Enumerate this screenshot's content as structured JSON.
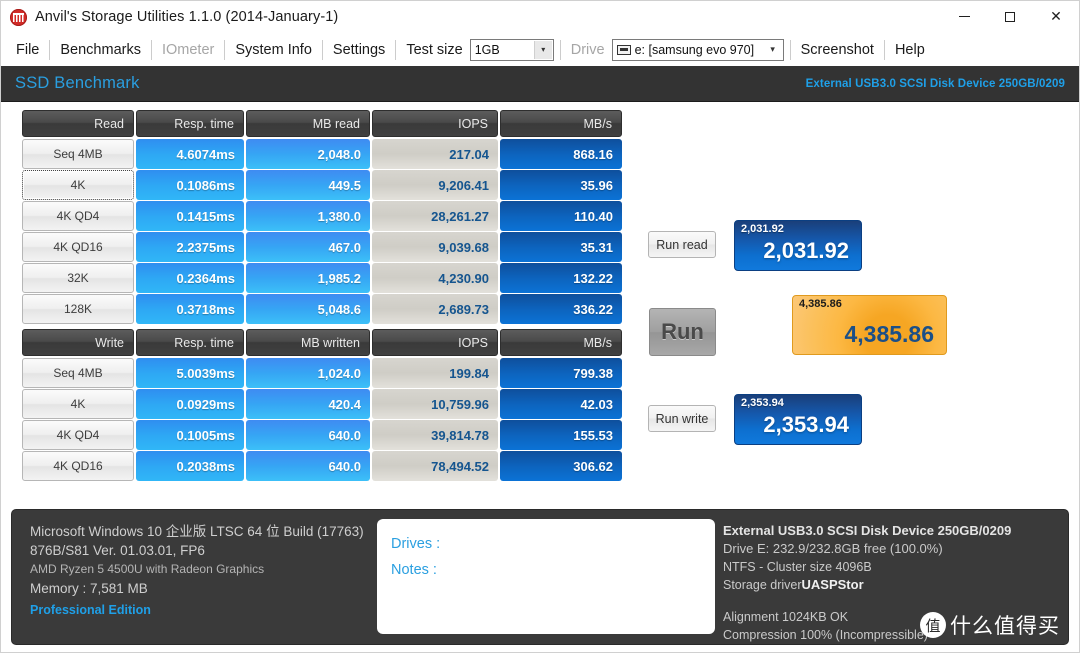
{
  "window": {
    "title": "Anvil's Storage Utilities 1.1.0 (2014-January-1)",
    "icon": "anvil-app-icon",
    "minimize": "–",
    "maximize": "□",
    "close": "✕"
  },
  "menu": {
    "items": [
      {
        "label": "File",
        "disabled": false
      },
      {
        "label": "Benchmarks",
        "disabled": false
      },
      {
        "label": "IOmeter",
        "disabled": true
      },
      {
        "label": "System Info",
        "disabled": false
      },
      {
        "label": "Settings",
        "disabled": false
      }
    ],
    "test_size_label": "Test size",
    "test_size_value": "1GB",
    "drive_label": "Drive",
    "drive_value": "e: [samsung evo 970]",
    "screenshot_label": "Screenshot",
    "help_label": "Help",
    "dropdown_arrow": "▾"
  },
  "header": {
    "title": "SSD Benchmark",
    "device": "External USB3.0 SCSI Disk Device 250GB/0209"
  },
  "read_table": {
    "headers": [
      "Read",
      "Resp. time",
      "MB read",
      "IOPS",
      "MB/s"
    ],
    "rows": [
      {
        "label": "Seq 4MB",
        "resp": "4.6074ms",
        "mb": "2,048.0",
        "iops": "217.04",
        "mbs": "868.16",
        "focused": false
      },
      {
        "label": "4K",
        "resp": "0.1086ms",
        "mb": "449.5",
        "iops": "9,206.41",
        "mbs": "35.96",
        "focused": true
      },
      {
        "label": "4K QD4",
        "resp": "0.1415ms",
        "mb": "1,380.0",
        "iops": "28,261.27",
        "mbs": "110.40",
        "focused": false
      },
      {
        "label": "4K QD16",
        "resp": "2.2375ms",
        "mb": "467.0",
        "iops": "9,039.68",
        "mbs": "35.31",
        "focused": false
      },
      {
        "label": "32K",
        "resp": "0.2364ms",
        "mb": "1,985.2",
        "iops": "4,230.90",
        "mbs": "132.22",
        "focused": false
      },
      {
        "label": "128K",
        "resp": "0.3718ms",
        "mb": "5,048.6",
        "iops": "2,689.73",
        "mbs": "336.22",
        "focused": false
      }
    ]
  },
  "write_table": {
    "headers": [
      "Write",
      "Resp. time",
      "MB written",
      "IOPS",
      "MB/s"
    ],
    "rows": [
      {
        "label": "Seq 4MB",
        "resp": "5.0039ms",
        "mb": "1,024.0",
        "iops": "199.84",
        "mbs": "799.38",
        "focused": false
      },
      {
        "label": "4K",
        "resp": "0.0929ms",
        "mb": "420.4",
        "iops": "10,759.96",
        "mbs": "42.03",
        "focused": false
      },
      {
        "label": "4K QD4",
        "resp": "0.1005ms",
        "mb": "640.0",
        "iops": "39,814.78",
        "mbs": "155.53",
        "focused": false
      },
      {
        "label": "4K QD16",
        "resp": "0.2038ms",
        "mb": "640.0",
        "iops": "78,494.52",
        "mbs": "306.62",
        "focused": false
      }
    ]
  },
  "controls": {
    "run_read": "Run read",
    "run": "Run",
    "run_write": "Run write"
  },
  "scores": {
    "read": {
      "small": "2,031.92",
      "big": "2,031.92"
    },
    "total": {
      "small": "4,385.86",
      "big": "4,385.86"
    },
    "write": {
      "small": "2,353.94",
      "big": "2,353.94"
    }
  },
  "system_info": {
    "os": "Microsoft Windows 10 企业版 LTSC 64 位 Build (17763)",
    "version": "876B/S81 Ver. 01.03.01, FP6",
    "cpu": "AMD Ryzen 5 4500U with Radeon Graphics",
    "memory": "Memory : 7,581 MB",
    "edition": "Professional Edition"
  },
  "notes_panel": {
    "drives_label": "Drives :",
    "notes_label": "Notes :"
  },
  "drive_info": {
    "device": "External USB3.0 SCSI Disk Device 250GB/0209",
    "capacity": "Drive E: 232.9/232.8GB free (100.0%)",
    "filesystem": "NTFS - Cluster size 4096B",
    "driver_label": "Storage driver",
    "driver_value": "UASPStor",
    "alignment": "Alignment 1024KB OK",
    "compression": "Compression 100% (Incompressible)"
  },
  "watermark": {
    "badge": "值",
    "text": "什么值得买"
  },
  "colors": {
    "accent_blue": "#2a9fe0",
    "header_dark": "#333333",
    "score_orange": "#f5a623",
    "score_blue": "#1079dc"
  }
}
